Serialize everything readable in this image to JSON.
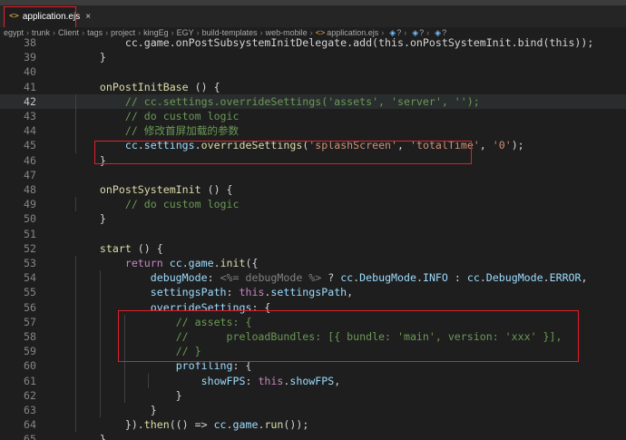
{
  "tab": {
    "label": "application.ejs",
    "close": "×",
    "icon": "file-code-icon"
  },
  "breadcrumb": {
    "segments": [
      "egypt",
      "trunk",
      "Client",
      "tags",
      "project",
      "kingEg",
      "EGY",
      "build-templates",
      "web-mobile",
      "application.ejs"
    ],
    "symbols": [
      "?",
      "?",
      "?"
    ]
  },
  "colors": {
    "keyword": "#c586c0",
    "function": "#dcdcaa",
    "variable": "#9cdcfe",
    "string": "#ce9178",
    "comment": "#6a9955",
    "highlight_box": "#e0202a"
  },
  "editor": {
    "current_line": 42,
    "lines": [
      {
        "n": 38,
        "tokens": [
          [
            "        cc.game.onPostSubsystemInitDelegate.add(this.onPostSystemInit.bind(this));",
            "pun"
          ]
        ]
      },
      {
        "n": 39,
        "tokens": [
          [
            "    }",
            "pun"
          ]
        ]
      },
      {
        "n": 40,
        "tokens": []
      },
      {
        "n": 41,
        "tokens": [
          [
            "    ",
            "pun"
          ],
          [
            "onPostInitBase",
            "fn"
          ],
          [
            " () {",
            "pun"
          ]
        ]
      },
      {
        "n": 42,
        "tokens": [
          [
            "        ",
            "pun"
          ],
          [
            "// cc.settings.overrideSettings('assets', 'server', '');",
            "cm"
          ]
        ]
      },
      {
        "n": 43,
        "tokens": [
          [
            "        ",
            "pun"
          ],
          [
            "// do custom logic",
            "cm"
          ]
        ]
      },
      {
        "n": 44,
        "tokens": [
          [
            "        ",
            "pun"
          ],
          [
            "// 修改首屏加载的参数",
            "cm"
          ]
        ]
      },
      {
        "n": 45,
        "tokens": [
          [
            "        ",
            "pun"
          ],
          [
            "cc",
            "var"
          ],
          [
            ".",
            "pun"
          ],
          [
            "settings",
            "var"
          ],
          [
            ".",
            "pun"
          ],
          [
            "overrideSettings",
            "fn"
          ],
          [
            "(",
            "pun"
          ],
          [
            "'splashScreen'",
            "str"
          ],
          [
            ", ",
            "pun"
          ],
          [
            "'totalTime'",
            "str"
          ],
          [
            ", ",
            "pun"
          ],
          [
            "'0'",
            "str"
          ],
          [
            ");",
            "pun"
          ]
        ]
      },
      {
        "n": 46,
        "tokens": [
          [
            "    }",
            "pun"
          ]
        ]
      },
      {
        "n": 47,
        "tokens": []
      },
      {
        "n": 48,
        "tokens": [
          [
            "    ",
            "pun"
          ],
          [
            "onPostSystemInit",
            "fn"
          ],
          [
            " () {",
            "pun"
          ]
        ]
      },
      {
        "n": 49,
        "tokens": [
          [
            "        ",
            "pun"
          ],
          [
            "// do custom logic",
            "cm"
          ]
        ]
      },
      {
        "n": 50,
        "tokens": [
          [
            "    }",
            "pun"
          ]
        ]
      },
      {
        "n": 51,
        "tokens": []
      },
      {
        "n": 52,
        "tokens": [
          [
            "    ",
            "pun"
          ],
          [
            "start",
            "fn"
          ],
          [
            " () {",
            "pun"
          ]
        ]
      },
      {
        "n": 53,
        "tokens": [
          [
            "        ",
            "pun"
          ],
          [
            "return",
            "kw"
          ],
          [
            " ",
            "pun"
          ],
          [
            "cc",
            "var"
          ],
          [
            ".",
            "pun"
          ],
          [
            "game",
            "var"
          ],
          [
            ".",
            "pun"
          ],
          [
            "init",
            "fn"
          ],
          [
            "({",
            "pun"
          ]
        ]
      },
      {
        "n": 54,
        "tokens": [
          [
            "            ",
            "pun"
          ],
          [
            "debugMode",
            "var"
          ],
          [
            ": ",
            "pun"
          ],
          [
            "<%= debugMode %>",
            "tag"
          ],
          [
            " ? ",
            "pun"
          ],
          [
            "cc",
            "var"
          ],
          [
            ".",
            "pun"
          ],
          [
            "DebugMode",
            "var"
          ],
          [
            ".",
            "pun"
          ],
          [
            "INFO",
            "var"
          ],
          [
            " : ",
            "pun"
          ],
          [
            "cc",
            "var"
          ],
          [
            ".",
            "pun"
          ],
          [
            "DebugMode",
            "var"
          ],
          [
            ".",
            "pun"
          ],
          [
            "ERROR",
            "var"
          ],
          [
            ",",
            "pun"
          ]
        ]
      },
      {
        "n": 55,
        "tokens": [
          [
            "            ",
            "pun"
          ],
          [
            "settingsPath",
            "var"
          ],
          [
            ": ",
            "pun"
          ],
          [
            "this",
            "kw"
          ],
          [
            ".",
            "pun"
          ],
          [
            "settingsPath",
            "var"
          ],
          [
            ",",
            "pun"
          ]
        ]
      },
      {
        "n": 56,
        "tokens": [
          [
            "            ",
            "pun"
          ],
          [
            "overrideSettings",
            "var"
          ],
          [
            ": {",
            "pun"
          ]
        ]
      },
      {
        "n": 57,
        "tokens": [
          [
            "                ",
            "pun"
          ],
          [
            "// assets: {",
            "cm"
          ]
        ]
      },
      {
        "n": 58,
        "tokens": [
          [
            "                ",
            "pun"
          ],
          [
            "//      preloadBundles: [{ bundle: 'main', version: 'xxx' }],",
            "cm"
          ]
        ]
      },
      {
        "n": 59,
        "tokens": [
          [
            "                ",
            "pun"
          ],
          [
            "// }",
            "cm"
          ]
        ]
      },
      {
        "n": 60,
        "tokens": [
          [
            "                ",
            "pun"
          ],
          [
            "profiling",
            "var"
          ],
          [
            ": {",
            "pun"
          ]
        ]
      },
      {
        "n": 61,
        "tokens": [
          [
            "                    ",
            "pun"
          ],
          [
            "showFPS",
            "var"
          ],
          [
            ": ",
            "pun"
          ],
          [
            "this",
            "kw"
          ],
          [
            ".",
            "pun"
          ],
          [
            "showFPS",
            "var"
          ],
          [
            ",",
            "pun"
          ]
        ]
      },
      {
        "n": 62,
        "tokens": [
          [
            "                }",
            "pun"
          ]
        ]
      },
      {
        "n": 63,
        "tokens": [
          [
            "            }",
            "pun"
          ]
        ]
      },
      {
        "n": 64,
        "tokens": [
          [
            "        }).",
            "pun"
          ],
          [
            "then",
            "fn"
          ],
          [
            "(() => ",
            "pun"
          ],
          [
            "cc",
            "var"
          ],
          [
            ".",
            "pun"
          ],
          [
            "game",
            "var"
          ],
          [
            ".",
            "pun"
          ],
          [
            "run",
            "fn"
          ],
          [
            "());",
            "pun"
          ]
        ]
      },
      {
        "n": 65,
        "tokens": [
          [
            "    }",
            "pun"
          ]
        ]
      }
    ]
  }
}
